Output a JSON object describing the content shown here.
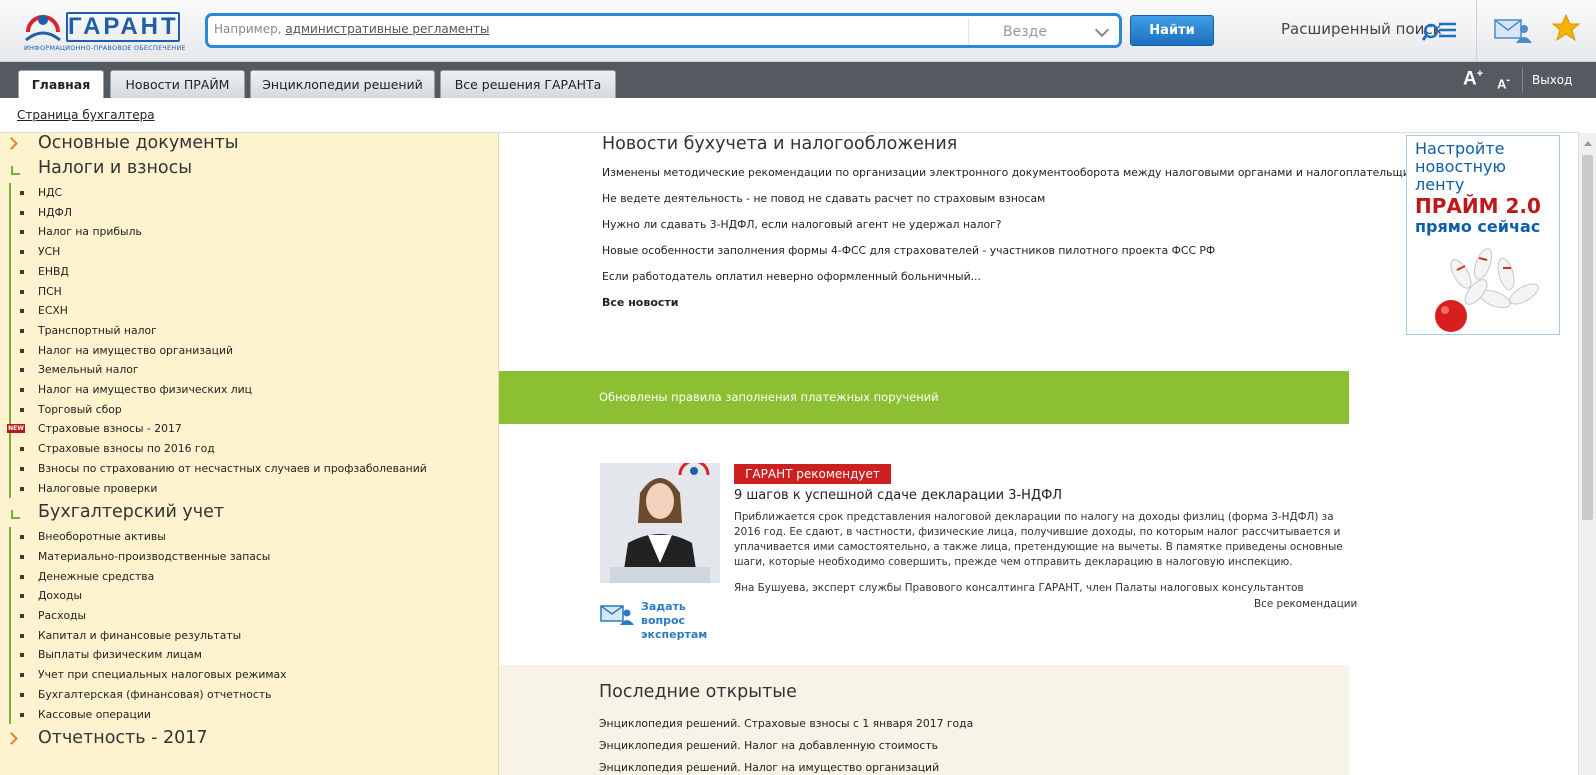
{
  "header": {
    "logo_text": "ГАРАНТ",
    "logo_subtitle": "ИНФОРМАЦИОННО-ПРАВОВОЕ ОБЕСПЕЧЕНИЕ",
    "search": {
      "placeholder_prefix": "Например,",
      "placeholder_link": "административные регламенты",
      "scope": "Везде",
      "button": "Найти"
    },
    "advanced_search": "Расширенный поиск",
    "icons": {
      "advanced": "advanced-search-icon",
      "mail": "mail-user-icon",
      "favorites": "star-icon"
    },
    "colors": {
      "accent": "#2a8ad4",
      "star": "#f4b400"
    }
  },
  "tabs": [
    {
      "label": "Главная",
      "active": true
    },
    {
      "label": "Новости ПРАЙМ",
      "active": false
    },
    {
      "label": "Энциклопедии решений",
      "active": false
    },
    {
      "label": "Все решения ГАРАНТа",
      "active": false
    }
  ],
  "toolbar": {
    "font_increase": "A",
    "font_increase_sup": "+",
    "font_decrease": "A",
    "font_decrease_sup": "-",
    "logout": "Выход"
  },
  "breadcrumb": "Страница бухгалтера",
  "sidebar": {
    "sections": [
      {
        "title": "Основные документы",
        "expanded": false,
        "items": []
      },
      {
        "title": "Налоги и взносы",
        "expanded": true,
        "items": [
          {
            "label": "НДС"
          },
          {
            "label": "НДФЛ"
          },
          {
            "label": "Налог на прибыль"
          },
          {
            "label": "УСН"
          },
          {
            "label": "ЕНВД"
          },
          {
            "label": "ПСН"
          },
          {
            "label": "ЕСХН"
          },
          {
            "label": "Транспортный налог"
          },
          {
            "label": "Налог на имущество организаций"
          },
          {
            "label": "Земельный налог"
          },
          {
            "label": "Налог на имущество физических лиц"
          },
          {
            "label": "Торговый сбор"
          },
          {
            "label": "Страховые взносы - 2017",
            "badge": "NEW"
          },
          {
            "label": "Страховые взносы по 2016 год"
          },
          {
            "label": "Взносы по страхованию от несчастных случаев и профзаболеваний"
          },
          {
            "label": "Налоговые проверки"
          }
        ]
      },
      {
        "title": "Бухгалтерский учет",
        "expanded": true,
        "items": [
          {
            "label": "Внеоборотные активы"
          },
          {
            "label": "Материально-производственные запасы"
          },
          {
            "label": "Денежные средства"
          },
          {
            "label": "Доходы"
          },
          {
            "label": "Расходы"
          },
          {
            "label": "Капитал и финансовые результаты"
          },
          {
            "label": "Выплаты физическим лицам"
          },
          {
            "label": "Учет при специальных налоговых режимах"
          },
          {
            "label": "Бухгалтерская (финансовая) отчетность"
          },
          {
            "label": "Кассовые операции"
          }
        ]
      },
      {
        "title": "Отчетность - 2017",
        "expanded": false,
        "items": []
      }
    ]
  },
  "news": {
    "title": "Новости бухучета и налогообложения",
    "items": [
      "Изменены методические рекомендации по организации электронного документооборота между налоговыми органами и налогоплательщиками",
      "Не ведете деятельность - не повод не сдавать расчет по страховым взносам",
      "Нужно ли сдавать 3-НДФЛ, если налоговый агент не удержал налог?",
      "Новые особенности заполнения формы 4-ФСС для страхователей - участников пилотного проекта ФСС РФ",
      "Если работодатель оплатил неверно оформленный больничный..."
    ],
    "all_link": "Все новости"
  },
  "promo": {
    "line1": "Настройте новостную ленту",
    "line2": "ПРАЙМ 2.0",
    "line3": "прямо сейчас"
  },
  "announcement": "Обновлены правила заполнения платежных поручений",
  "recommendation": {
    "badge": "ГАРАНТ рекомендует",
    "title": "9 шагов к успешной сдаче декларации 3-НДФЛ",
    "text": "Приближается срок представления налоговой декларации по налогу на доходы физлиц (форма 3-НДФЛ) за 2016 год. Ее сдают, в частности, физические лица, получившие доходы, по которым налог рассчитывается и уплачивается ими самостоятельно, а также лица, претендующие на вычеты. В памятке приведены основные шаги, которые необходимо совершить, прежде чем отправить декларацию в налоговую инспекцию.",
    "author": "Яна Бушуева, эксперт службы Правового консалтинга ГАРАНТ, член Палаты налоговых консультантов",
    "all_link": "Все рекомендации",
    "ask_expert": "Задать вопрос экспертам"
  },
  "recent": {
    "title": "Последние открытые",
    "items": [
      "Энциклопедия решений. Страховые взносы с 1 января 2017 года",
      "Энциклопедия решений. Налог на добавленную стоимость",
      "Энциклопедия решений. Налог на имущество организаций"
    ]
  }
}
